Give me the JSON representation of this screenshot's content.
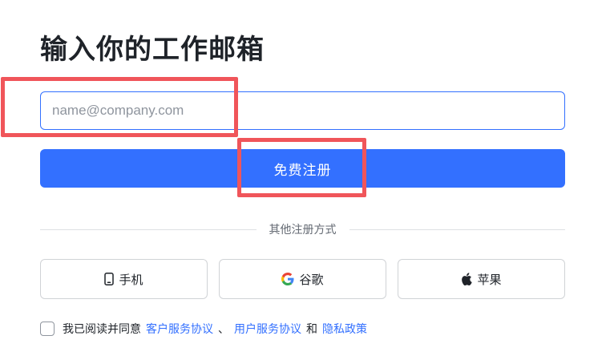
{
  "title": "输入你的工作邮箱",
  "email": {
    "value": "",
    "placeholder": "name@company.com"
  },
  "signup_label": "免费注册",
  "divider_text": "其他注册方式",
  "alt_methods": {
    "phone": "手机",
    "google": "谷歌",
    "apple": "苹果"
  },
  "agreement": {
    "prefix": "我已阅读并同意",
    "link1": "客户服务协议",
    "sep1": "、",
    "link2": "用户服务协议",
    "sep2": "和",
    "link3": "隐私政策"
  },
  "colors": {
    "primary": "#3370ff",
    "annotation": "#f0555a",
    "text": "#1f2329",
    "muted": "#646a73"
  }
}
